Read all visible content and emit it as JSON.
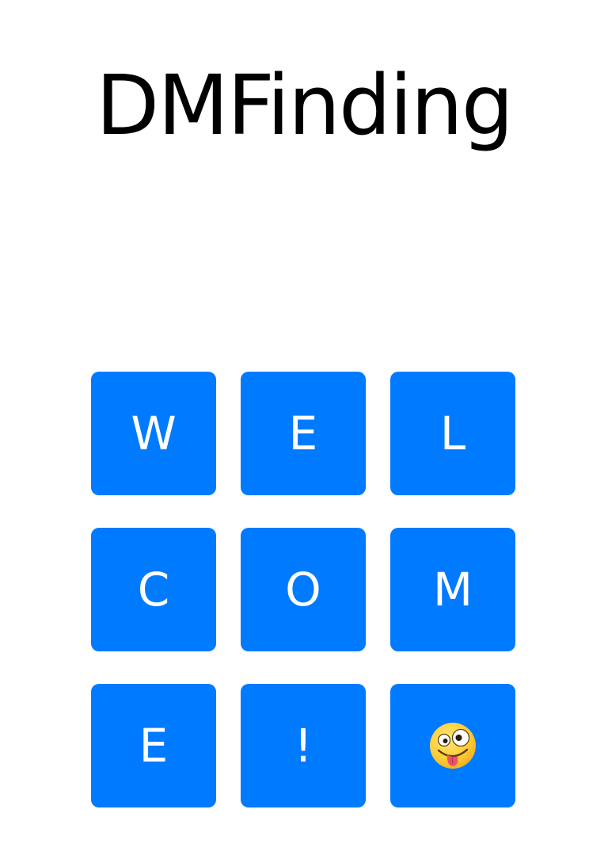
{
  "app": {
    "title": "DMFinding"
  },
  "theme": {
    "tile_color": "#007AFF",
    "tile_text_color": "#FFFFFF",
    "background": "#FFFFFF"
  },
  "grid": {
    "tiles": [
      {
        "label": "W"
      },
      {
        "label": "E"
      },
      {
        "label": "L"
      },
      {
        "label": "C"
      },
      {
        "label": "O"
      },
      {
        "label": "M"
      },
      {
        "label": "E"
      },
      {
        "label": "!"
      },
      {
        "icon": "zany-face-emoji-icon"
      }
    ]
  }
}
